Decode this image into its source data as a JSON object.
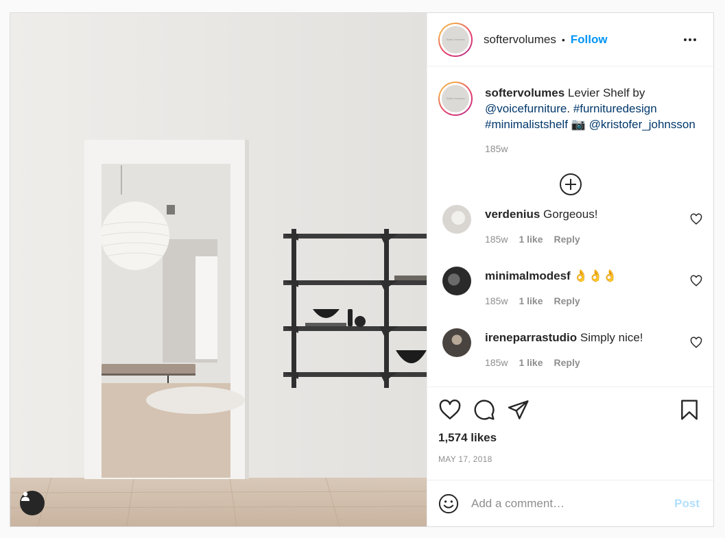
{
  "header": {
    "username": "softervolumes",
    "avatar_text": "Softer Volumes",
    "separator": "•",
    "follow_label": "Follow",
    "more_icon": "more-horizontal-icon"
  },
  "caption": {
    "username": "softervolumes",
    "text_plain": " Levier Shelf by ",
    "mention_1": "@voicefurniture",
    "period": ". ",
    "hashtag_1": "#furnituredesign",
    "hashtag_2": "#minimalistshelf",
    "camera_emoji": " 📷 ",
    "mention_2": "@kristofer_johnsson",
    "time": "185w"
  },
  "comments": [
    {
      "username": "verdenius",
      "text": " Gorgeous!",
      "time": "185w",
      "likes": "1 like",
      "reply": "Reply"
    },
    {
      "username": "minimalmodesf",
      "text": " 👌👌👌",
      "time": "185w",
      "likes": "1 like",
      "reply": "Reply"
    },
    {
      "username": "ireneparrastudio",
      "text": " Simply nice!",
      "time": "185w",
      "likes": "1 like",
      "reply": "Reply"
    }
  ],
  "actions": {
    "likes": "1,574 likes",
    "date": "MAY 17, 2018"
  },
  "add_comment": {
    "placeholder": "Add a comment…",
    "post_label": "Post"
  },
  "colors": {
    "accent": "#0095f6",
    "post_disabled": "#b2dffc",
    "link": "#00376b",
    "secondary_text": "#8e8e8e"
  }
}
